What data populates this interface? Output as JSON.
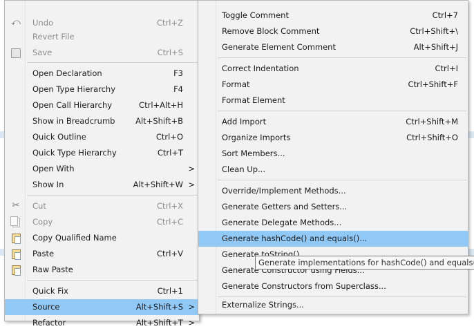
{
  "context_menu": {
    "items": [
      {
        "label": "Undo",
        "shortcut": "Ctrl+Z",
        "disabled": true,
        "icon": "undo-icon"
      },
      {
        "label": "Revert File",
        "shortcut": "",
        "disabled": true
      },
      {
        "label": "Save",
        "shortcut": "Ctrl+S",
        "disabled": true,
        "icon": "save-icon"
      },
      {
        "label": "Open Declaration",
        "shortcut": "F3"
      },
      {
        "label": "Open Type Hierarchy",
        "shortcut": "F4"
      },
      {
        "label": "Open Call Hierarchy",
        "shortcut": "Ctrl+Alt+H"
      },
      {
        "label": "Show in Breadcrumb",
        "shortcut": "Alt+Shift+B"
      },
      {
        "label": "Quick Outline",
        "shortcut": "Ctrl+O"
      },
      {
        "label": "Quick Type Hierarchy",
        "shortcut": "Ctrl+T"
      },
      {
        "label": "Open With",
        "shortcut": "",
        "submenu": true
      },
      {
        "label": "Show In",
        "shortcut": "Alt+Shift+W",
        "submenu": true
      },
      {
        "label": "Cut",
        "shortcut": "Ctrl+X",
        "disabled": true,
        "icon": "cut-icon"
      },
      {
        "label": "Copy",
        "shortcut": "Ctrl+C",
        "disabled": true,
        "icon": "copy-icon"
      },
      {
        "label": "Copy Qualified Name",
        "shortcut": "",
        "icon": "copy-qualified-name-icon"
      },
      {
        "label": "Paste",
        "shortcut": "Ctrl+V",
        "icon": "paste-icon"
      },
      {
        "label": "Raw Paste",
        "shortcut": "",
        "icon": "raw-paste-icon"
      },
      {
        "label": "Quick Fix",
        "shortcut": "Ctrl+1"
      },
      {
        "label": "Source",
        "shortcut": "Alt+Shift+S",
        "submenu": true,
        "highlighted": true
      },
      {
        "label": "Refactor",
        "shortcut": "Alt+Shift+T",
        "submenu": true
      }
    ]
  },
  "source_submenu": {
    "items": [
      {
        "label": "Toggle Comment",
        "shortcut": "Ctrl+7"
      },
      {
        "label": "Remove Block Comment",
        "shortcut": "Ctrl+Shift+\\"
      },
      {
        "label": "Generate Element Comment",
        "shortcut": "Alt+Shift+J"
      },
      {
        "label": "Correct Indentation",
        "shortcut": "Ctrl+I"
      },
      {
        "label": "Format",
        "shortcut": "Ctrl+Shift+F"
      },
      {
        "label": "Format Element",
        "shortcut": ""
      },
      {
        "label": "Add Import",
        "shortcut": "Ctrl+Shift+M"
      },
      {
        "label": "Organize Imports",
        "shortcut": "Ctrl+Shift+O"
      },
      {
        "label": "Sort Members...",
        "shortcut": ""
      },
      {
        "label": "Clean Up...",
        "shortcut": ""
      },
      {
        "label": "Override/Implement Methods...",
        "shortcut": ""
      },
      {
        "label": "Generate Getters and Setters...",
        "shortcut": ""
      },
      {
        "label": "Generate Delegate Methods...",
        "shortcut": ""
      },
      {
        "label": "Generate hashCode() and equals()...",
        "shortcut": "",
        "highlighted": true
      },
      {
        "label": "Generate toString()...",
        "shortcut": ""
      },
      {
        "label": "Generate Constructor using Fields...",
        "shortcut": ""
      },
      {
        "label": "Generate Constructors from Superclass...",
        "shortcut": ""
      },
      {
        "label": "Externalize Strings...",
        "shortcut": ""
      }
    ]
  },
  "submenu_arrow": ">",
  "tooltip": "Generate implementations for hashCode() and equals()"
}
